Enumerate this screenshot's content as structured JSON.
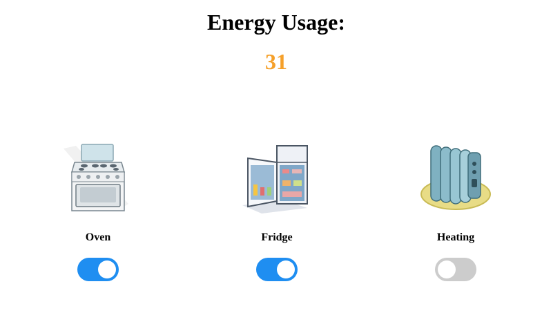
{
  "header": {
    "title": "Energy Usage:",
    "usage_value": "31",
    "usage_color": "#f5a02a"
  },
  "devices": [
    {
      "label": "Oven",
      "icon": "oven-icon",
      "on": true
    },
    {
      "label": "Fridge",
      "icon": "fridge-icon",
      "on": true
    },
    {
      "label": "Heating",
      "icon": "heater-icon",
      "on": false
    }
  ],
  "colors": {
    "toggle_on": "#1f8ef1",
    "toggle_off": "#cccccc"
  }
}
